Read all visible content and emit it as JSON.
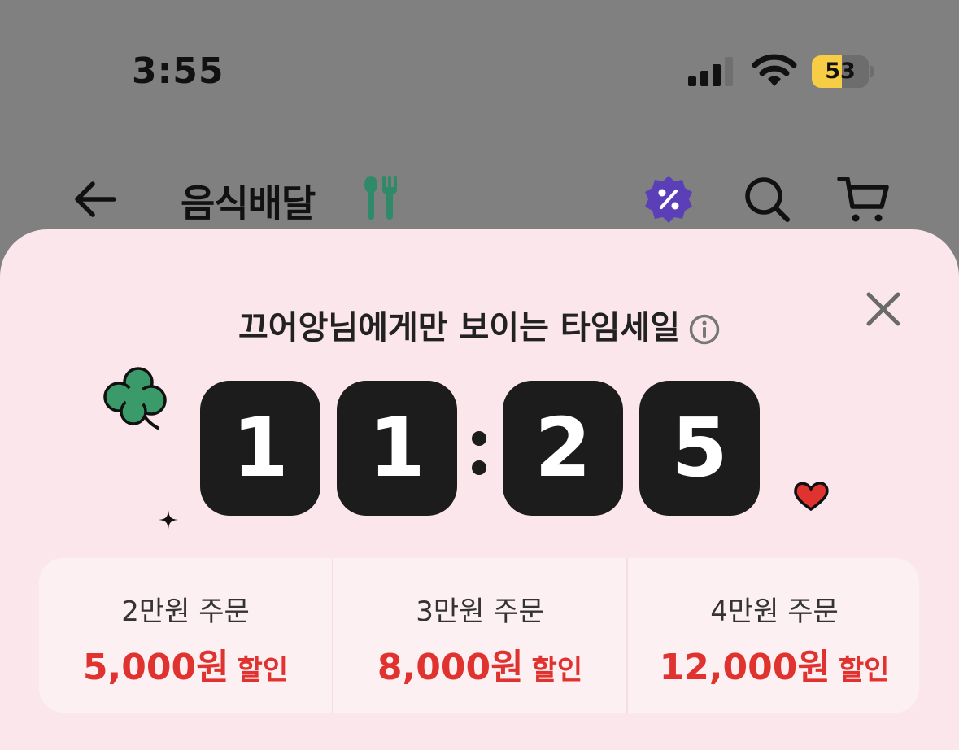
{
  "status_bar": {
    "time": "3:55",
    "battery": "53",
    "battery_level_percent": 53,
    "signal_icon": "cellular-signal-icon",
    "wifi_icon": "wifi-icon"
  },
  "header": {
    "title": "음식배달",
    "title_icon": "utensils-icon",
    "back_icon": "back-arrow-icon",
    "promo_icon": "discount-badge-icon",
    "search_icon": "search-icon",
    "cart_icon": "cart-icon"
  },
  "timesale": {
    "title": "끄어앙님에게만 보이는 타임세일",
    "timer_digits": [
      "1",
      "1",
      "2",
      "5"
    ],
    "offers": [
      {
        "condition": "2만원 주문",
        "amount": "5,000원",
        "suffix": "할인"
      },
      {
        "condition": "3만원 주문",
        "amount": "8,000원",
        "suffix": "할인"
      },
      {
        "condition": "4만원 주문",
        "amount": "12,000원",
        "suffix": "할인"
      }
    ]
  },
  "colors": {
    "status_background": "#808080",
    "sheet_background": "#fbe6ec",
    "timer_tile": "#1c1c1c",
    "discount_red": "#e0322e",
    "battery_yellow": "#f6cd45",
    "promo_purple": "#5b3fb8"
  }
}
